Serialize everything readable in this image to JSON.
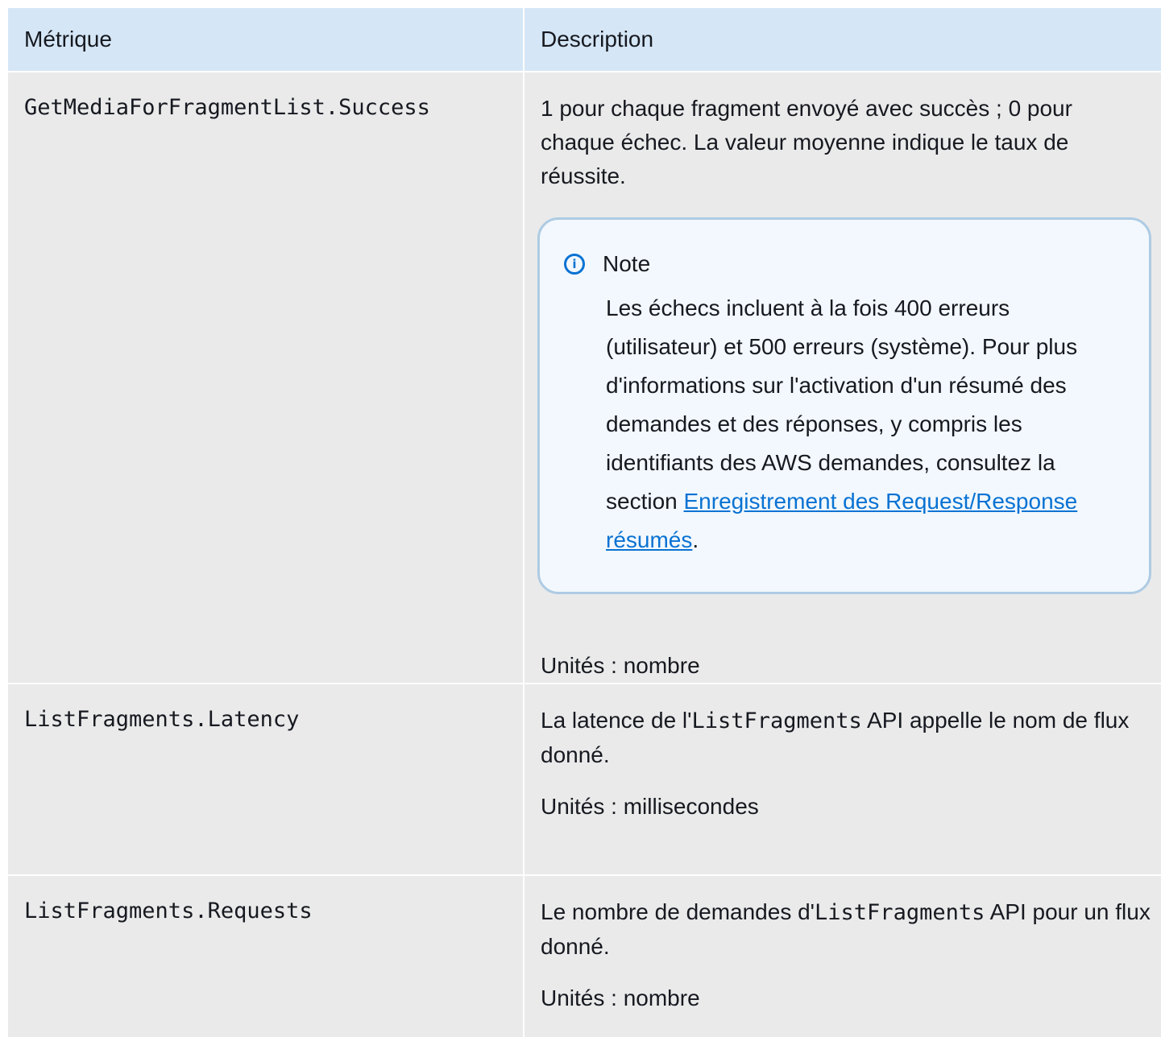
{
  "table": {
    "headers": [
      "Métrique",
      "Description"
    ],
    "rows": [
      {
        "metric": "GetMediaForFragmentList.Success",
        "description": "1 pour chaque fragment envoyé avec succès ; 0 pour chaque échec. La valeur moyenne indique le taux de réussite.",
        "note": {
          "title": "Note",
          "text_before": "Les échecs incluent à la fois 400 erreurs (utilisateur) et 500 erreurs (système). Pour plus d'informations sur l'activation d'un résumé des demandes et des réponses, y compris les identifiants des AWS demandes, consultez la section ",
          "link_text": "Enregistrement des Request/Response résumés",
          "text_after": "."
        },
        "units": "Unités : nombre"
      },
      {
        "metric": "ListFragments.Latency",
        "description_before": "La latence de l'",
        "description_code": "ListFragments",
        "description_after": " API appelle le nom de flux donné.",
        "units": "Unités : millisecondes"
      },
      {
        "metric": "ListFragments.Requests",
        "description_before": "Le nombre de demandes d'",
        "description_code": "ListFragments",
        "description_after": " API pour un flux donné.",
        "units": "Unités : nombre"
      }
    ]
  },
  "icons": {
    "note_icon": "info-circle-icon"
  },
  "colors": {
    "header_bg": "#d5e6f6",
    "row_bg": "#eaeaeb",
    "note_border": "#aecbe3",
    "link": "#0972d3"
  }
}
